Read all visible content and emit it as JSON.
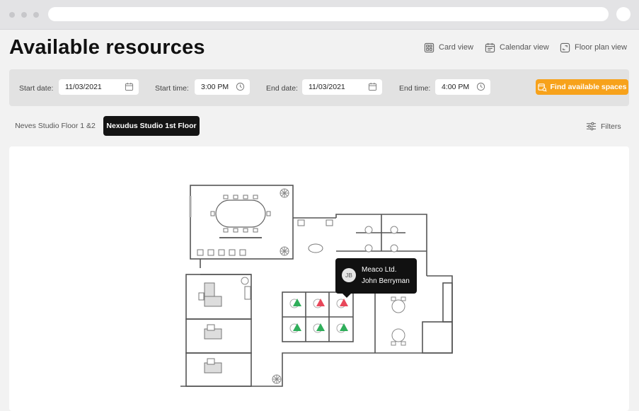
{
  "page": {
    "title": "Available resources"
  },
  "views": [
    {
      "label": "Card view",
      "icon": "card-view-icon"
    },
    {
      "label": "Calendar view",
      "icon": "calendar-view-icon"
    },
    {
      "label": "Floor plan view",
      "icon": "floor-plan-view-icon"
    }
  ],
  "filters": {
    "start_date_label": "Start date:",
    "start_date_value": "11/03/2021",
    "start_time_label": "Start time:",
    "start_time_value": "3:00 PM",
    "end_date_label": "End date:",
    "end_date_value": "11/03/2021",
    "end_time_label": "End time:",
    "end_time_value": "4:00 PM",
    "find_button_label": "Find available spaces"
  },
  "tabs": [
    {
      "label": "Neves Studio Floor 1 &2",
      "active": false
    },
    {
      "label": "Nexudus Studio 1st Floor",
      "active": true
    }
  ],
  "filters_button_label": "Filters",
  "tooltip": {
    "initials": "JB",
    "company": "Meaco Ltd.",
    "person": "John Berryman"
  },
  "colors": {
    "accent": "#f7a21b",
    "available": "#2fae5a",
    "booked": "#e8475a",
    "active_tab": "#141414"
  }
}
